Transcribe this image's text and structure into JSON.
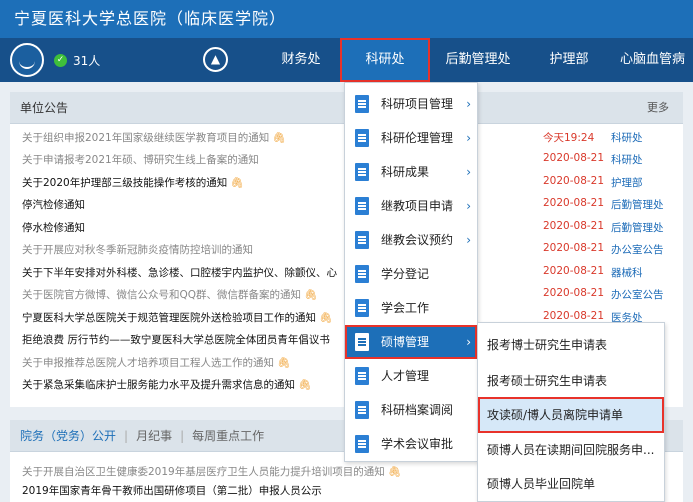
{
  "header": {
    "title": "宁夏医科大学总医院（临床医学院）"
  },
  "topbar": {
    "online_count": "31人",
    "check": "✓",
    "home": "▲"
  },
  "nav": {
    "items": [
      {
        "label": "财务处"
      },
      {
        "label": "科研处"
      },
      {
        "label": "后勤管理处"
      },
      {
        "label": "护理部"
      },
      {
        "label": "心脑血管病"
      }
    ]
  },
  "notices_panel": {
    "title": "单位公告",
    "more": "更多",
    "items": [
      {
        "title": "关于组织申报2021年国家级继续医学教育项目的通知",
        "attach": true,
        "date": "今天19:24",
        "dept": "科研处"
      },
      {
        "title": "关于申请报考2021年硕、博研究生线上备案的通知",
        "attach": false,
        "date": "2020-08-21",
        "dept": "科研处"
      },
      {
        "title": "关于2020年护理部三级技能操作考核的通知",
        "attach": true,
        "date": "2020-08-21",
        "dept": "护理部"
      },
      {
        "title": "停汽检修通知",
        "attach": false,
        "date": "2020-08-21",
        "dept": "后勤管理处"
      },
      {
        "title": "停水检修通知",
        "attach": false,
        "date": "2020-08-21",
        "dept": "后勤管理处"
      },
      {
        "title": "关于开展应对秋冬季新冠肺炎疫情防控培训的通知",
        "attach": false,
        "date": "2020-08-21",
        "dept": "办公室公告"
      },
      {
        "title": "关于下半年安排对外科楼、急诊楼、口腔楼宇内监护仪、除颤仪、心",
        "attach": false,
        "date": "2020-08-21",
        "dept": "器械科"
      },
      {
        "title": "关于医院官方微博、微信公众号和QQ群、微信群备案的通知",
        "attach": true,
        "date": "2020-08-21",
        "dept": "办公室公告"
      },
      {
        "title": "宁夏医科大学总医院关于规范管理医院外送检验项目工作的通知",
        "attach": true,
        "date": "2020-08-21",
        "dept": "医务处"
      },
      {
        "title": "拒绝浪费 厉行节约——致宁夏医科大学总医院全体团员青年倡议书",
        "attach": false,
        "date": "",
        "dept": ""
      },
      {
        "title": "关于申报推荐总医院人才培养项目工程人选工作的通知",
        "attach": true,
        "date": "",
        "dept": ""
      },
      {
        "title": "关于紧急采集临床护士服务能力水平及提升需求信息的通知",
        "attach": true,
        "date": "",
        "dept": ""
      }
    ]
  },
  "bottom_panel": {
    "tabs": [
      "院务（党务）公开",
      "月纪事",
      "每周重点工作"
    ],
    "items": [
      {
        "title": "关于开展自治区卫生健康委2019年基层医疗卫生人员能力提升培训项目的通知",
        "attach": true
      },
      {
        "title": "2019年国家青年骨干教师出国研修项目（第二批）申报人员公示",
        "attach": false
      }
    ]
  },
  "submenu": {
    "items": [
      {
        "label": "科研项目管理"
      },
      {
        "label": "科研伦理管理"
      },
      {
        "label": "科研成果"
      },
      {
        "label": "继教项目申请"
      },
      {
        "label": "继教会议预约"
      },
      {
        "label": "学分登记"
      },
      {
        "label": "学会工作"
      },
      {
        "label": "硕博管理"
      },
      {
        "label": "人才管理"
      },
      {
        "label": "科研档案调阅"
      },
      {
        "label": "学术会议审批"
      }
    ],
    "chevron": "›"
  },
  "flyout": {
    "items": [
      {
        "label": "报考博士研究生申请表"
      },
      {
        "label": "报考硕士研究生申请表"
      },
      {
        "label": "攻读硕/博人员离院申请单"
      },
      {
        "label": "硕博人员在读期间回院服务申..."
      },
      {
        "label": "硕博人员毕业回院单"
      }
    ]
  },
  "colors": {
    "header_blue": "#1d6fb8",
    "nav_blue": "#17508a",
    "highlight_red": "#e8322a",
    "date_red": "#d9392b",
    "dept_blue": "#1e6cb8",
    "attach_orange": "#f0a030"
  }
}
